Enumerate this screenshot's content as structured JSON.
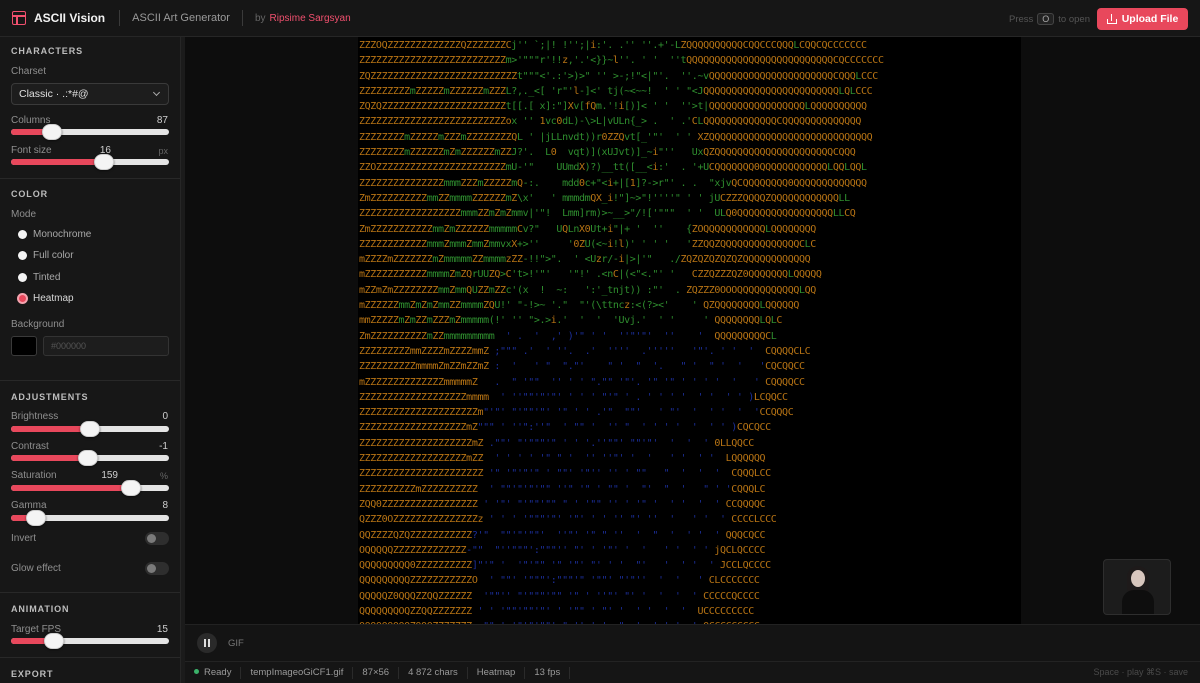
{
  "header": {
    "app_name": "ASCII Vision",
    "subtitle": "ASCII Art Generator",
    "by": "by",
    "author": "Ripsime Sargsyan",
    "hint_press": "Press",
    "hint_key": "O",
    "hint_to_open": "to open",
    "upload_label": "Upload File"
  },
  "sidebar": {
    "characters": {
      "title": "CHARACTERS",
      "charset_label": "Charset",
      "charset_value": "Classic · .:*#@",
      "columns_label": "Columns",
      "columns_value": "87",
      "columns_level": 0.26,
      "font_size_label": "Font size",
      "font_size_value": "16",
      "font_size_unit": "px",
      "font_size_level": 0.59
    },
    "color": {
      "title": "COLOR",
      "mode_label": "Mode",
      "modes": [
        "Monochrome",
        "Full color",
        "Tinted",
        "Heatmap"
      ],
      "selected_mode": "Heatmap",
      "background_label": "Background",
      "background_hex": "#000000",
      "background_color": "#000000"
    },
    "adjustments": {
      "title": "ADJUSTMENTS",
      "brightness_label": "Brightness",
      "brightness_value": "0",
      "brightness_level": 0.5,
      "contrast_label": "Contrast",
      "contrast_value": "-1",
      "contrast_level": 0.49,
      "saturation_label": "Saturation",
      "saturation_value": "159",
      "saturation_unit": "%",
      "saturation_level": 0.76,
      "gamma_label": "Gamma",
      "gamma_value": "8",
      "gamma_level": 0.16,
      "invert_label": "Invert",
      "invert_on": false,
      "glow_label": "Glow effect",
      "glow_on": false
    },
    "animation": {
      "title": "ANIMATION",
      "fps_label": "Target FPS",
      "fps_value": "15",
      "fps_level": 0.27
    },
    "export": {
      "title": "EXPORT"
    }
  },
  "player": {
    "format_label": "GIF",
    "state": "playing"
  },
  "status": {
    "state": "Ready",
    "filename": "tempImageoGiCF1.gif",
    "grid": "87×56",
    "chars": "4 872 chars",
    "mode": "Heatmap",
    "fps": "13 fps",
    "shortcuts": "Space · play   ⌘S · save"
  },
  "colors": {
    "accent": "#e8485c",
    "author": "#f0506e",
    "heat_warm": "#b87414",
    "heat_mid": "#2f8f2f",
    "heat_cool": "#1c2f9c",
    "status_ok": "#3bb26a"
  },
  "ascii_art": [
    {
      "t": "ZZZOQZZZZZZZZZZZZZQZZZZZZZCj'' `;|! !'';|i:'. .'' ''.+'-LZQQQQQQQQQQCQQCCCQQQLCQQCQCCCCCCC"
    },
    {
      "t": "ZZZZZZZZZZZZZZZZZZZZZZZZZZm>'\"\"\"r'!!z,'.'<}}~l''. ' '  ''tQQQQQQQQQQQQQQQQQQQQQQQQQQCQCCCCCCC"
    },
    {
      "t": "ZQZZZZZZZZZZZZZZZZZZZZZZZZZZt\"\"\"<'.:'>)>\" '' >-;!\"<|\"'.  ''.~vQQQQQQQOQQQQQQQQQQQQQQCQQQLCCC"
    },
    {
      "t": "ZZZZZZZZZmZZZZZmZZZZZZmZZZL?,._<[ 'r\"'l-]<' tj(~<~~!  ' ' \"<JQQQQQQQQQQQQQQQQQQQQQQQQLQLCCC"
    },
    {
      "t": "ZQZQZZZZZZZZZZZZZZZZZZZZZZt[[.[ x]:\"]Xv[fQm.'!i[)]< ' '  ''>t|QQQQQQQQQQQQQQQQQLQQQQQQQQQQ"
    },
    {
      "t": "ZZZZZZZZZZZZZZZZZZZZZZZZZZox '' 1vc0dL)-\\>L|vULn{_> .  ' .'CLQQQQQQQQQQQQQCQQQQQQQQQQQQQQ"
    },
    {
      "t": "ZZZZZZZZmZZZZZmZZZmZZZZZZZZQL ' |jLLnvdt))r0ZZQvt[_'\"'  ' ' XZQQQQQQQQQQQQQQQQQQQQQQQQQQQQQ"
    },
    {
      "t": "ZZZZZZZZmZZZZZZmZmZZZZZZmZZJ?'.  L0  vqt)](xUJvt)]_~i\"''   UxQZQQQQQQQQQQQQQQQQQQQQQCQQQ"
    },
    {
      "t": "ZZOZZZZZZZZZZZZZZZZZZZZZZZmU-'\"    UUmdX)?)__tt([__<i:'  . '+UCQQQQQQQ0QQQQQQQQQQQQLQQLQQL"
    },
    {
      "t": "ZZZZZZZZZZZZZZZmmmZZZmZZZZZmQ-:.    mdd0c+\"<i+|[1]?->r\"' . .  \"xjvQCQQQQQQQQ0QQQQQQQQQQQQQ"
    },
    {
      "t": "ZmZZZZZZZZZZmmZZmmmmZZZZZZmZ\\x'   ' mmmdmQX_i!\"]~>\"!''''\" ' ' jUCZZZQQQQZQQQQQQQQQQQQLL"
    },
    {
      "t": "ZZZZZZZZZZZZZZZZZZmmmZZmZmZmmv|'\"!  Lmm]rm)>~__>\"/!['\"\"\"  ' '  ULQ0QQQQQQQQQQQQQQQQQLLCQ"
    },
    {
      "t": "ZmZZZZZZZZZZZmmZmZZZZZZmmmmmCv?\"   UQLnX0Ut+i\"|+ '  ''    {ZOQQQQQQQQQQQLQQQQQQQQ"
    },
    {
      "t": "ZZZZZZZZZZZZmmmZmmmZmmZmmvxX+>''     '0ZU(<~i!l)' ' ' '   'ZZQQZQQQQQQQQQQQQQQCLC"
    },
    {
      "t": "mZZZZmZZZZZZZmZmmmmmZZmmmmzZZ-!!\">\".  ' <Uzr/-i|>|'\"   ./ZQZQZQZQZQZQQQQQQQQQQQQ"
    },
    {
      "t": "mZZZZZZZZZZZmmmmZmZQrUUZQ>C't>!'\"'   '\"!' .<nC|(<\"<.\"' '   CZZQZZZQZ0QQQQQQQLQQQQQ"
    },
    {
      "t": "mZZmZmZZZZZZZZmmZmmQUZZmZZc'(x  !  ~:   ':'_tnjt)) :\"'  . ZQZZZ0OOOQQQQQQQQQQQLQQ"
    },
    {
      "t": "mZZZZZZmmZmZmZmmZZmmmmZQU!' \"-!>~ '.\"  \"'(\\ttncz:<(?><'    ' QZQQQQQQQQLQQQQQQ"
    },
    {
      "t": "mmZZZZZmZmZZmZZZmZmmmmm(!' '' \">.>i.'  '  '  'Uvj.'  ' '     ' QQQQQQQQLQLC"
    },
    {
      "t": "ZmZZZZZZZZZZmZZmmmmmmmmm  ' .  '  ,' )'\" ' '  ''\"'\"'  ''    '  QQQQQQQQQCL"
    },
    {
      "t": "ZZZZZZZZZmmZZZZmZZZZmmZ ;\"\"\" .'  ' ''.  .'  ''''  .'''''   '\"'. ' '  '  CQQQQCLC"
    },
    {
      "t": "ZZZZZZZZZZmmmmZmZZmZZmZ :  '   ' \"  \".\"'    \" '  \"  '.   \" '  \" '  '   'CQCQQCC"
    },
    {
      "t": "mZZZZZZZZZZZZZZmmmmmZ   .  \" '\"\"  '' ' ' \".\"\" '\"'. '\" '\" ' ' ' '  '   ' CQQQQCC"
    },
    {
      "t": "ZZZZZZZZZZZZZZZZZZZmmmm  ' ''\"\"'\"'\"' ' ' ' \"'\" ' . ' ' ' '  ' '  ' ' )LCQQCC"
    },
    {
      "t": "ZZZZZZZZZZZZZZZZZZZZZm\"'\"' \"'\"\"'\"' '\" ' ' .'\"  \"\"'   ' \"'  '  ' '  '  'CCQQQC"
    },
    {
      "t": "ZZZZZZZZZZZZZZZZZZZmZ\"\"\" ' ''\":''\"  ' \"\" '  '' \"  ' ' ' '  '  ' ' )CQCQCC"
    },
    {
      "t": "ZZZZZZZZZZZZZZZZZZZZmZ .\"\"' \"'\"\"\"'\" ' ' '.''\"\"' \"\"'\"'  '  '  ' 0LLQQCC"
    },
    {
      "t": "ZZZZZZZZZZZZZZZZZZZmZZ  ' ' ' ' '\" \" '  '' ''\"' '  '   ' '  ' '  LQQQQQQ"
    },
    {
      "t": "ZZZZZZZZZZZZZZZZZZZZZZ '\" '\"'\"'\" ' \"\"' '\"'' '' ' \"\"   \"  '  '  '  CQQQLCC"
    },
    {
      "t": "ZZZZZZZZZZmZZZZZZZZZZ  ' \"\"'\"'\"'\"\" ''\" '\" ' \"\" '  \"'  \"  '   \" ' 'CQQQLC"
    },
    {
      "t": "ZQQ0ZZZZZZZZZZZZZZZZZ ' '\"' \"'\"\"'\"\" \" ' '\"\" '' ' '\" '  ' '  '  ' CCQQQQC"
    },
    {
      "t": "QZZZ0OZZZZZZZZZZZZZZZz ' ' ' '\"\"\"'\"' '\"' ' ' '' \"' ''  '   ' '  ' CCCCLCCC"
    },
    {
      "t": "QQZZZZQZQZZZZZZZZZZZ?'\"  \"\"'\"'\"\"'  ''\"' '\" \" ''  '  \"  '  ' '  ' QQQCQCC"
    },
    {
      "t": "OQQQQQZZZZZZZZZZZZZ-\"\"  \"''\"\"\"':\"\"\"'' \"' ' '\"' '  '   ' '  ' ' jQCLQCCCC"
    },
    {
      "t": "QQQQQQQQQ0ZZZZZZZZZZ]\"'\" '  '\"'\"\" '\" '\"' \"' ' '  \"'   '  ' '  ' JCCLQCCCC"
    },
    {
      "t": "QQQQQQQQQZZZZZZZZZZZO  ' \"\"' '\"\"\"':\"\"\"'\" '\"\"' \"'\"''  '  '   ' CLCCCCCCC"
    },
    {
      "t": "QQQQQZ0QQQZZQQZZZZZZ  '\"\"'' \"'\"\"\"'\"\" '\" ' ''\"' \"' '  '  '  ' CCCCCQCCCC"
    },
    {
      "t": "QQQQQQQOQZZQQZZZZZZZ ' ' '\"\"'\"\"'\"' ' '\"\" ' \"' '  ' '  '  '  UCCCCCCCCC"
    },
    {
      "t": "QQQQQQQOQZQQQZZZZZZZ  \"\" ' '\"'\"'\"\"' \" '' ' '  \"  '  ' ' '  ' QCCCCCCCCC"
    }
  ]
}
